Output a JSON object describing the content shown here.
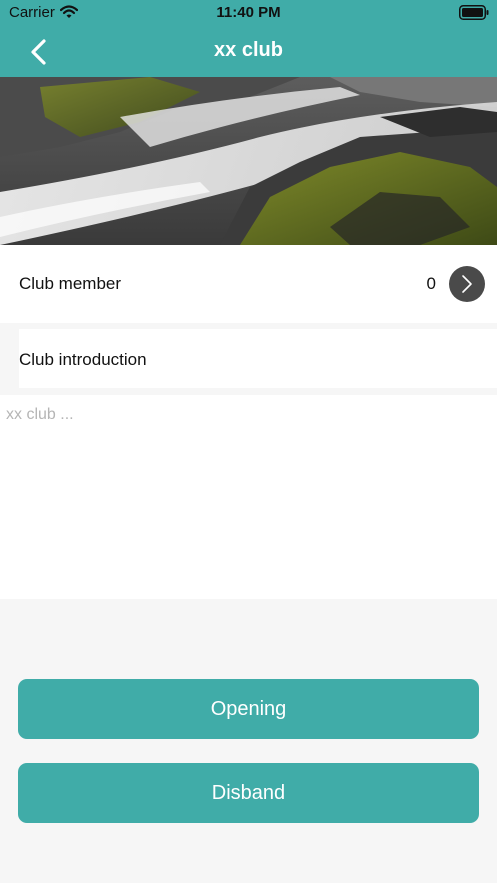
{
  "status_bar": {
    "carrier": "Carrier",
    "time": "11:40 PM",
    "icons": [
      "wifi-icon",
      "battery-icon"
    ]
  },
  "nav": {
    "title": "xx club",
    "back_icon": "chevron-left-icon"
  },
  "hero": {
    "image": "waterfall-over-mossy-rocks"
  },
  "members": {
    "label": "Club member",
    "count": "0",
    "icon": "chevron-right-icon"
  },
  "intro": {
    "label": "Club introduction",
    "placeholder": "xx club ..."
  },
  "actions": {
    "opening_label": "Opening",
    "disband_label": "Disband"
  },
  "colors": {
    "accent": "#40aca8",
    "background": "#f6f6f6",
    "chevron_button": "#4a4a4a",
    "placeholder_text": "#b5b5b5"
  }
}
